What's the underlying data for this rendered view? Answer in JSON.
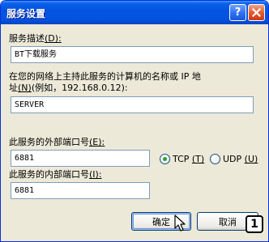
{
  "window": {
    "title": "服务设置",
    "help_glyph": "?",
    "close_glyph": "×"
  },
  "form": {
    "description": {
      "label": "服务描述",
      "accel": "(D):",
      "value": "BT下载服务"
    },
    "host": {
      "label_line1": "在您的网络上主持此服务的计算机的名称或 IP 地",
      "label_line2": "址",
      "accel": "(N)",
      "label_tail": "(例如，192.168.0.12):",
      "value": "SERVER"
    },
    "external_port": {
      "label": "此服务的外部端口号",
      "accel": "(E):",
      "value": "6881"
    },
    "internal_port": {
      "label": "此服务的内部端口号",
      "accel": "(I):",
      "value": "6881"
    },
    "protocol": {
      "tcp_label": "TCP",
      "tcp_accel": "(T)",
      "udp_label": "UDP",
      "udp_accel": "(U)",
      "selected": "TCP"
    }
  },
  "buttons": {
    "ok": "确定",
    "cancel": "取消"
  },
  "annotation": {
    "marker": "1"
  }
}
